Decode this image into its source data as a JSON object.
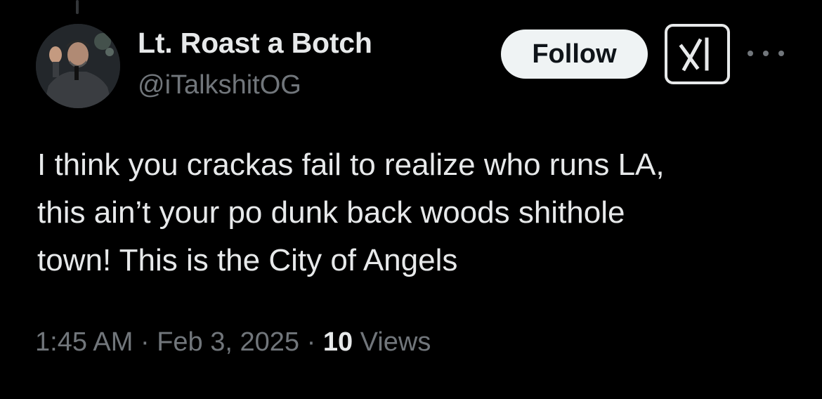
{
  "author": {
    "display_name": "Lt. Roast a Botch",
    "handle": "@iTalkshitOG"
  },
  "actions": {
    "follow_label": "Follow",
    "grok_icon": "grok-icon",
    "more_icon": "more-options-icon"
  },
  "tweet": {
    "lines": [
      "I think you crackas fail to realize who runs LA,",
      "this ain’t your po dunk back woods shithole",
      "town! This is the City of Angels"
    ]
  },
  "meta": {
    "time": "1:45 AM",
    "separator": " · ",
    "date": "Feb 3, 2025",
    "views_count": "10",
    "views_label": " Views"
  },
  "colors": {
    "background": "#000000",
    "primary_text": "#e7e9ea",
    "secondary_text": "#71767b",
    "follow_bg": "#eff3f4"
  }
}
